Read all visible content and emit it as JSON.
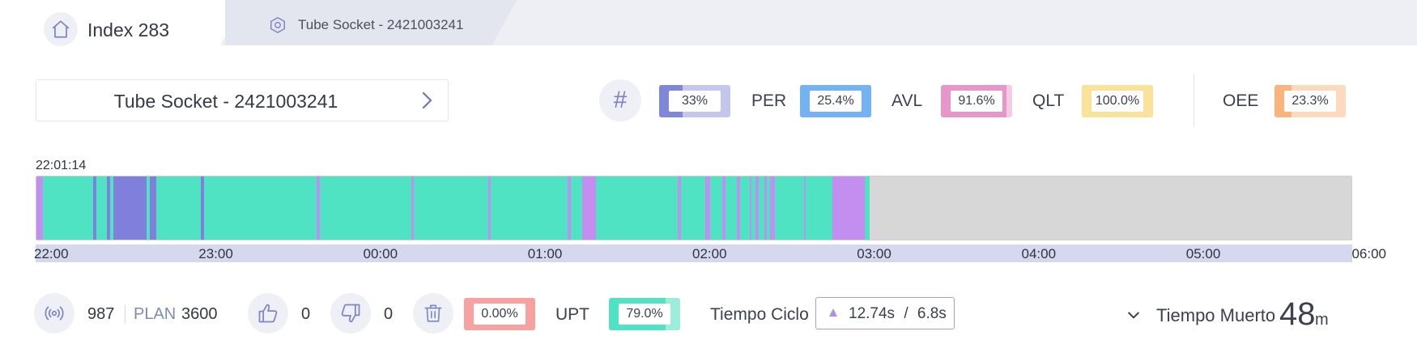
{
  "tabs": [
    {
      "label": "Index 283",
      "icon": "home-icon"
    },
    {
      "label": "Tube Socket - 2421003241",
      "icon": "hexagon-icon"
    }
  ],
  "selector": {
    "label": "Tube Socket - 2421003241",
    "icon": "chevron-right-icon"
  },
  "kpis": {
    "hash_icon": "hash-icon",
    "items": [
      {
        "label": "",
        "value": "33%",
        "fraction": 0.33,
        "color": "#8087d9",
        "bg": "#c4c6ee"
      },
      {
        "label": "PER",
        "value": "25.4%",
        "fraction": 1.0,
        "color": "#74b3f2",
        "bg": "#74b3f2"
      },
      {
        "label": "AVL",
        "value": "91.6%",
        "fraction": 0.916,
        "color": "#e696c8",
        "bg": "#f3cbe3"
      },
      {
        "label": "QLT",
        "value": "100.0%",
        "fraction": 1.0,
        "color": "#fbe29a",
        "bg": "#fbe29a"
      },
      {
        "label": "OEE",
        "value": "23.3%",
        "fraction": 0.233,
        "color": "#fbb37e",
        "bg": "#fdd9bd"
      }
    ]
  },
  "timeline": {
    "start_time": "22:01:14",
    "hours": 8,
    "ticks": [
      "22:00",
      "23:00",
      "00:00",
      "01:00",
      "02:00",
      "03:00",
      "04:00",
      "05:00",
      "06:00"
    ],
    "colors": {
      "running": "#4fe3c3",
      "stop": "#8080dc",
      "micro": "#c48ef0",
      "idle": "#d7d7d7"
    },
    "segments": [
      {
        "s": 0.0,
        "e": 0.04,
        "t": "micro"
      },
      {
        "s": 0.04,
        "e": 0.345,
        "t": "running"
      },
      {
        "s": 0.345,
        "e": 0.365,
        "t": "stop"
      },
      {
        "s": 0.365,
        "e": 0.43,
        "t": "running"
      },
      {
        "s": 0.43,
        "e": 0.45,
        "t": "stop"
      },
      {
        "s": 0.45,
        "e": 0.47,
        "t": "running"
      },
      {
        "s": 0.47,
        "e": 0.67,
        "t": "stop"
      },
      {
        "s": 0.67,
        "e": 0.69,
        "t": "running"
      },
      {
        "s": 0.69,
        "e": 0.73,
        "t": "stop"
      },
      {
        "s": 0.73,
        "e": 1.0,
        "t": "running"
      },
      {
        "s": 1.0,
        "e": 1.02,
        "t": "stop"
      },
      {
        "s": 1.02,
        "e": 1.705,
        "t": "running"
      },
      {
        "s": 1.705,
        "e": 1.725,
        "t": "micro"
      },
      {
        "s": 1.725,
        "e": 2.28,
        "t": "running"
      },
      {
        "s": 2.28,
        "e": 2.295,
        "t": "micro"
      },
      {
        "s": 2.295,
        "e": 2.75,
        "t": "running"
      },
      {
        "s": 2.75,
        "e": 2.765,
        "t": "micro"
      },
      {
        "s": 2.765,
        "e": 3.232,
        "t": "running"
      },
      {
        "s": 3.232,
        "e": 3.25,
        "t": "micro"
      },
      {
        "s": 3.25,
        "e": 3.32,
        "t": "running"
      },
      {
        "s": 3.32,
        "e": 3.345,
        "t": "micro"
      },
      {
        "s": 3.345,
        "e": 3.405,
        "t": "micro"
      },
      {
        "s": 3.405,
        "e": 3.43,
        "t": "running"
      },
      {
        "s": 3.43,
        "e": 3.9,
        "t": "running"
      },
      {
        "s": 3.9,
        "e": 3.92,
        "t": "micro"
      },
      {
        "s": 3.92,
        "e": 4.07,
        "t": "running"
      },
      {
        "s": 4.07,
        "e": 4.1,
        "t": "micro"
      },
      {
        "s": 4.1,
        "e": 4.17,
        "t": "running"
      },
      {
        "s": 4.17,
        "e": 4.19,
        "t": "micro"
      },
      {
        "s": 4.19,
        "e": 4.26,
        "t": "running"
      },
      {
        "s": 4.26,
        "e": 4.28,
        "t": "micro"
      },
      {
        "s": 4.28,
        "e": 4.34,
        "t": "running"
      },
      {
        "s": 4.34,
        "e": 4.35,
        "t": "micro"
      },
      {
        "s": 4.35,
        "e": 4.375,
        "t": "running"
      },
      {
        "s": 4.375,
        "e": 4.395,
        "t": "micro"
      },
      {
        "s": 4.395,
        "e": 4.43,
        "t": "running"
      },
      {
        "s": 4.43,
        "e": 4.445,
        "t": "micro"
      },
      {
        "s": 4.445,
        "e": 4.465,
        "t": "running"
      },
      {
        "s": 4.465,
        "e": 4.495,
        "t": "micro"
      },
      {
        "s": 4.495,
        "e": 4.67,
        "t": "running"
      },
      {
        "s": 4.67,
        "e": 4.68,
        "t": "micro"
      },
      {
        "s": 4.68,
        "e": 4.84,
        "t": "running"
      },
      {
        "s": 4.84,
        "e": 5.04,
        "t": "micro"
      },
      {
        "s": 5.04,
        "e": 5.07,
        "t": "running"
      }
    ]
  },
  "stats": {
    "produced": "987",
    "plan_label": "PLAN",
    "plan": "3600",
    "good": "0",
    "bad": "0",
    "scrap_rate": {
      "value": "0.00%",
      "fraction": 1.0,
      "color": "#f7a1a1"
    },
    "upt": {
      "label": "UPT",
      "value": "79.0%",
      "fraction": 0.79,
      "color": "#4fe3c3",
      "bg": "#9cedda"
    },
    "ciclo": {
      "label": "Tiempo Ciclo",
      "actual": "12.74s",
      "separator": "/",
      "target": "6.8s"
    },
    "muerto": {
      "label": "Tiempo Muerto",
      "value": "48",
      "unit": "m"
    },
    "icons": [
      "signal-icon",
      "thumbs-up-icon",
      "thumbs-down-icon",
      "trash-icon",
      "triangle-up-icon",
      "chevron-down-icon"
    ]
  }
}
